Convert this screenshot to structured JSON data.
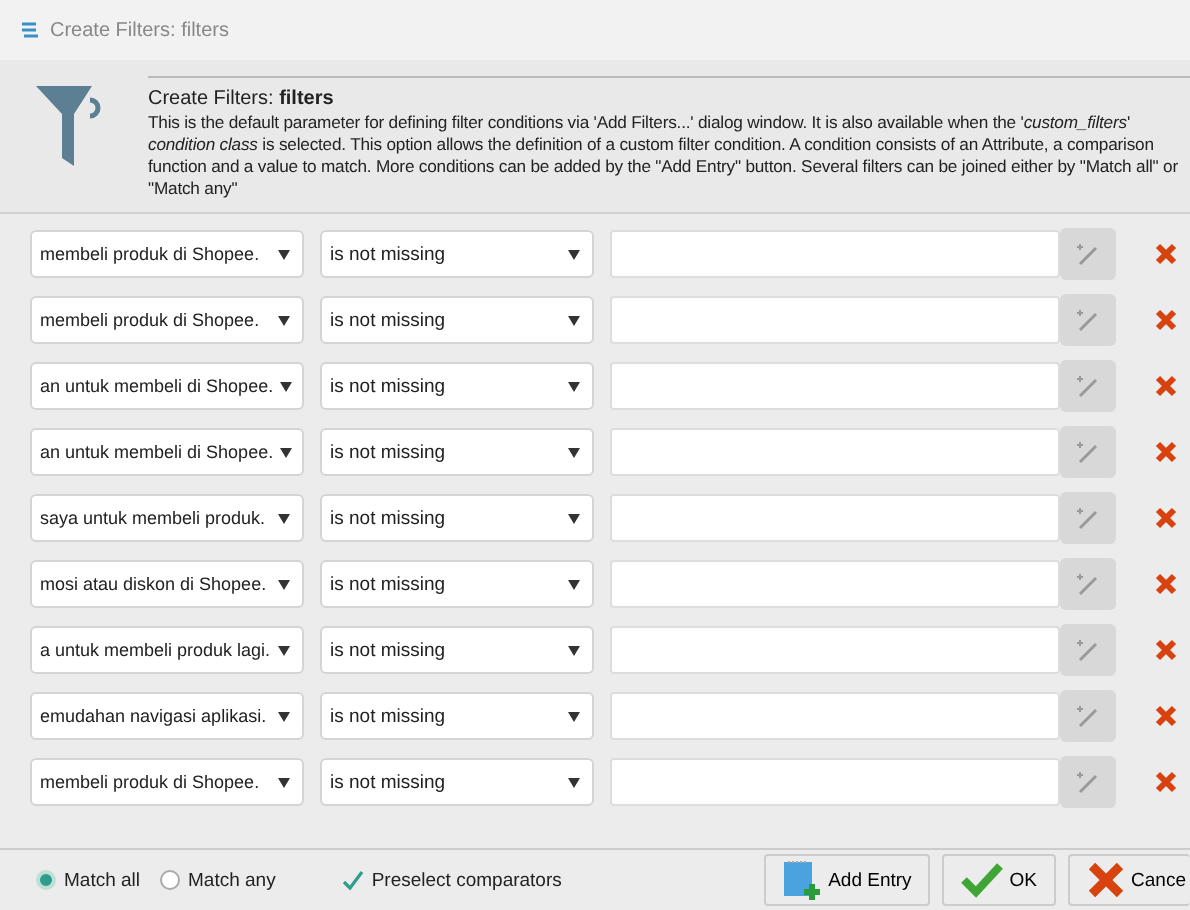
{
  "window": {
    "title": "Create Filters: filters"
  },
  "header": {
    "title": "Create Filters: ",
    "title_bold": "filters",
    "description": "This is the default parameter for defining filter conditions via 'Add Filters...' dialog window. It is also available when the '*custom_filters*' *condition class* is selected. This option allows the definition of a custom filter condition. A condition consists of an Attribute, a comparison function and a value to match. More conditions can be added by the \"Add Entry\" button. Several filters can be joined either by \"Match all\" or \"Match any\""
  },
  "rows": [
    {
      "attribute": "membeli produk di Shopee.",
      "comparison": "is not missing"
    },
    {
      "attribute": "membeli produk di Shopee.",
      "comparison": "is not missing"
    },
    {
      "attribute": "an untuk membeli di Shopee.",
      "comparison": "is not missing"
    },
    {
      "attribute": "an untuk membeli di Shopee.",
      "comparison": "is not missing"
    },
    {
      "attribute": "saya untuk membeli produk.",
      "comparison": "is not missing"
    },
    {
      "attribute": "mosi atau diskon di Shopee.",
      "comparison": "is not missing"
    },
    {
      "attribute": "a untuk membeli produk lagi.",
      "comparison": "is not missing"
    },
    {
      "attribute": "emudahan navigasi aplikasi.",
      "comparison": "is not missing"
    },
    {
      "attribute": "membeli produk di Shopee.",
      "comparison": "is not missing"
    }
  ],
  "match": [
    {
      "label": "Match all",
      "selected": true
    },
    {
      "label": "Match any",
      "selected": false
    }
  ],
  "preselect": {
    "label": "Preselect comparators",
    "checked": true
  },
  "buttons": [
    {
      "kind": "add",
      "label": "Add Entry"
    },
    {
      "kind": "ok",
      "label": "OK"
    },
    {
      "kind": "cancel",
      "label": "Cance"
    }
  ]
}
